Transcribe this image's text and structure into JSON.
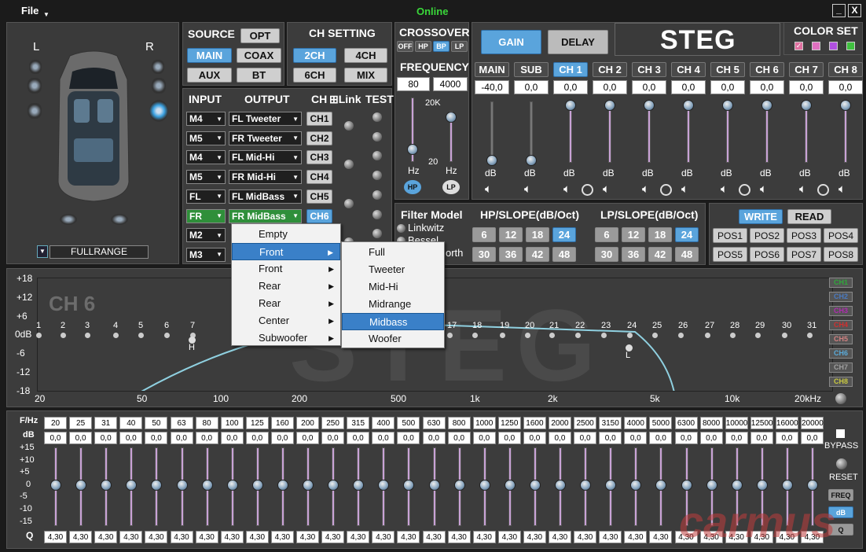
{
  "titlebar": {
    "file": "File",
    "status": "Online",
    "minimize": "_",
    "close": "X"
  },
  "car": {
    "left": "L",
    "right": "R",
    "mode": "FULLRANGE"
  },
  "source": {
    "title": "SOURCE",
    "buttons": [
      "OPT",
      "MAIN",
      "COAX",
      "AUX",
      "BT"
    ],
    "active": "MAIN"
  },
  "chsetting": {
    "title": "CH SETTING",
    "buttons": [
      "2CH",
      "4CH",
      "6CH",
      "MIX"
    ],
    "active": "2CH"
  },
  "crossover": {
    "title": "CROSSOVER",
    "buttons": [
      "OFF",
      "HP",
      "BP",
      "LP"
    ],
    "active": "BP",
    "freq_title": "FREQUENCY",
    "hp_value": "80",
    "lp_value": "4000",
    "top": "20K",
    "bottom": "20",
    "hz": "Hz",
    "hp_btn": "HP",
    "lp_btn": "LP"
  },
  "routing": {
    "h_input": "INPUT",
    "h_output": "OUTPUT",
    "h_ch": "CH",
    "h_link": "⊞Link",
    "h_test": "TEST",
    "rows": [
      {
        "in": "M4",
        "out": "FL Tweeter",
        "ch": "CH1"
      },
      {
        "in": "M5",
        "out": "FR Tweeter",
        "ch": "CH2"
      },
      {
        "in": "M4",
        "out": "FL Mid-Hi",
        "ch": "CH3"
      },
      {
        "in": "M5",
        "out": "FR Mid-Hi",
        "ch": "CH4"
      },
      {
        "in": "FL",
        "out": "FL MidBass",
        "ch": "CH5"
      },
      {
        "in": "FR",
        "out": "FR MidBass",
        "ch": "CH6"
      },
      {
        "in": "M2",
        "out": "",
        "ch": ""
      },
      {
        "in": "M3",
        "out": "",
        "ch": ""
      }
    ]
  },
  "gainpanel": {
    "gain": "GAIN",
    "delay": "DELAY",
    "logo": "STEG",
    "channels": [
      {
        "name": "MAIN",
        "value": "-40,0"
      },
      {
        "name": "SUB",
        "value": "0,0"
      },
      {
        "name": "CH 1",
        "value": "0,0"
      },
      {
        "name": "CH 2",
        "value": "0,0"
      },
      {
        "name": "CH 3",
        "value": "0,0"
      },
      {
        "name": "CH 4",
        "value": "0,0"
      },
      {
        "name": "CH 5",
        "value": "0,0"
      },
      {
        "name": "CH 6",
        "value": "0,0"
      },
      {
        "name": "CH 7",
        "value": "0,0"
      },
      {
        "name": "CH 8",
        "value": "0,0"
      }
    ],
    "db": "dB",
    "active": "CH 1"
  },
  "colorset": {
    "title": "COLOR SET",
    "swatches": [
      "#e070a0",
      "#e070c0",
      "#b050e0",
      "#40c040"
    ]
  },
  "filter": {
    "title": "Filter Model",
    "opt1": "Linkwitz",
    "opt2": "Bessel",
    "opt3": "Butterworth",
    "opt3_visible": "orth",
    "hp_title": "HP/SLOPE(dB/Oct)",
    "lp_title": "LP/SLOPE(dB/Oct)",
    "hp_slopes": [
      "6",
      "12",
      "18",
      "24",
      "30",
      "36",
      "42",
      "48"
    ],
    "lp_slopes": [
      "6",
      "12",
      "18",
      "24",
      "30",
      "36",
      "42",
      "48"
    ],
    "hp_active": "24",
    "lp_active": "24"
  },
  "memory": {
    "write": "WRITE",
    "read": "READ",
    "pos": [
      "POS1",
      "POS2",
      "POS3",
      "POS4",
      "POS5",
      "POS6",
      "POS7",
      "POS8"
    ]
  },
  "graph": {
    "channel": "CH 6",
    "yticks": [
      "+18",
      "+12",
      "+6",
      "0dB",
      "-6",
      "-12",
      "-18"
    ],
    "xticks": [
      "20",
      "50",
      "100",
      "200",
      "500",
      "1k",
      "2k",
      "5k",
      "10k",
      "20kHz"
    ],
    "points_visible": [
      "1",
      "2",
      "3",
      "4",
      "5",
      "6",
      "7",
      "17",
      "18",
      "19",
      "20",
      "21",
      "22",
      "23",
      "24",
      "25",
      "26",
      "27",
      "28",
      "29",
      "30",
      "31"
    ],
    "marker_h": "H",
    "marker_l": "L",
    "legend": [
      {
        "name": "CH1",
        "color": "#2fa83a"
      },
      {
        "name": "CH2",
        "color": "#4a7ac0"
      },
      {
        "name": "CH3",
        "color": "#b02ab0"
      },
      {
        "name": "CH4",
        "color": "#d03030"
      },
      {
        "name": "CH5",
        "color": "#d08080"
      },
      {
        "name": "CH6",
        "color": "#5aaad8"
      },
      {
        "name": "CH7",
        "color": "#a0a0a0"
      },
      {
        "name": "CH8",
        "color": "#c8c840"
      }
    ]
  },
  "eq": {
    "fhz": "F/Hz",
    "db": "dB",
    "q": "Q",
    "freqs": [
      "20",
      "25",
      "31",
      "40",
      "50",
      "63",
      "80",
      "100",
      "125",
      "160",
      "200",
      "250",
      "315",
      "400",
      "500",
      "630",
      "800",
      "1000",
      "1250",
      "1600",
      "2000",
      "2500",
      "3150",
      "4000",
      "5000",
      "6300",
      "8000",
      "10000",
      "12500",
      "16000",
      "20000"
    ],
    "gain": "0,0",
    "qval": "4,30",
    "scale": [
      "+15",
      "+10",
      "+5",
      "0",
      "-5",
      "-10",
      "-15"
    ],
    "bypass": "BYPASS",
    "reset": "RESET",
    "freq": "FREQ",
    "dbbtn": "dB",
    "qbtn": "Q"
  },
  "menu1": [
    "Empty",
    "Front",
    "Front",
    "Rear",
    "Rear",
    "Center",
    "Subwoofer"
  ],
  "menu2": [
    "Full",
    "Tweeter",
    "Mid-Hi",
    "Midrange",
    "Midbass",
    "Woofer"
  ],
  "menu2_active": "Midbass",
  "watermark": "carmus"
}
